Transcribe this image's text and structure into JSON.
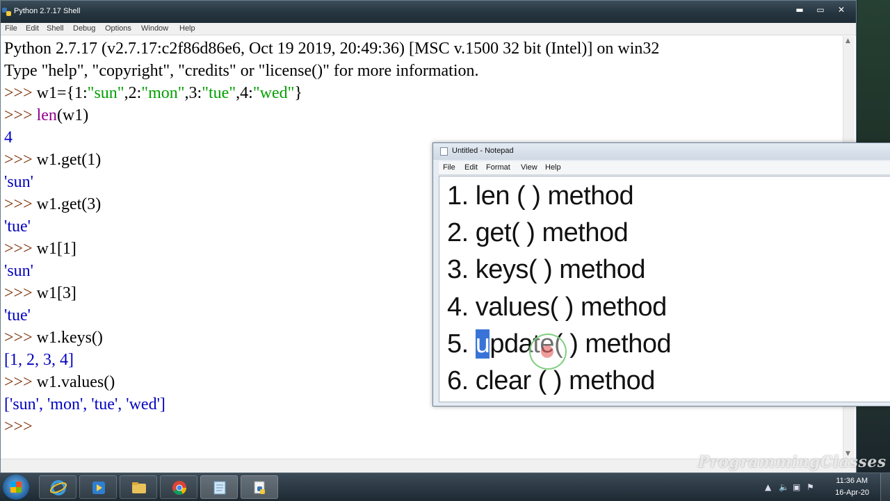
{
  "idle": {
    "title": "Python 2.7.17 Shell",
    "window_controls": {
      "minimize": "▬",
      "maximize": "▭",
      "close": "✕"
    },
    "menu": [
      "File",
      "Edit",
      "Shell",
      "Debug",
      "Options",
      "Window",
      "Help"
    ],
    "banner1": "Python 2.7.17 (v2.7.17:c2f86d86e6, Oct 19 2019, 20:49:36) [MSC v.1500 32 bit (Intel)] on win32",
    "banner2": "Type \"help\", \"copyright\", \"credits\" or \"license()\" for more information.",
    "prompt": ">>> ",
    "lines": {
      "l3_pre": "w1={1:",
      "l3_s1": "\"sun\"",
      "l3_m1": ",2:",
      "l3_s2": "\"mon\"",
      "l3_m2": ",3:",
      "l3_s3": "\"tue\"",
      "l3_m3": ",4:",
      "l3_s4": "\"wed\"",
      "l3_end": "}",
      "l4_fn": "len",
      "l4_rest": "(w1)",
      "o4": "4",
      "c5": "w1.get(1)",
      "o5": "'sun'",
      "c6": "w1.get(3)",
      "o6": "'tue'",
      "c7": "w1[1]",
      "o7": "'sun'",
      "c8": "w1[3]",
      "o8": "'tue'",
      "c9": "w1.keys()",
      "o9": "[1, 2, 3, 4]",
      "c10": "w1.values()",
      "o10": "['sun', 'mon', 'tue', 'wed']"
    }
  },
  "notepad": {
    "title": "Untitled - Notepad",
    "menu": [
      "File",
      "Edit",
      "Format",
      "View",
      "Help"
    ],
    "items": [
      "1. len ( ) method",
      "2. get( ) method",
      "3. keys( ) method",
      "4. values( ) method",
      "6. clear ( ) method"
    ],
    "item5": {
      "num": "5. ",
      "selected": "u",
      "rest": "pdate( ) method"
    }
  },
  "watermark": "ProgrammingClasses",
  "taskbar": {
    "time": "11:36 AM",
    "date": "16-Apr-20"
  },
  "colors": {
    "prompt": "#7a2b00",
    "string": "#00a000",
    "output": "#0000c0",
    "builtin": "#900090",
    "selection": "#3874d8"
  }
}
